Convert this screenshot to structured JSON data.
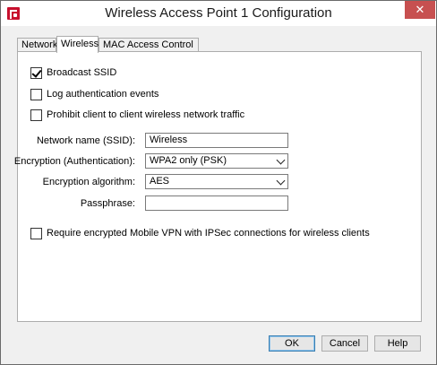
{
  "window": {
    "title": "Wireless Access Point 1 Configuration",
    "close_glyph": "✕",
    "icon": "watchguard-app-icon"
  },
  "tabs": [
    {
      "label": "Network",
      "active": false
    },
    {
      "label": "Wireless",
      "active": true
    },
    {
      "label": "MAC Access Control",
      "active": false
    }
  ],
  "options": {
    "broadcast_ssid": {
      "label": "Broadcast SSID",
      "checked": true
    },
    "log_auth": {
      "label": "Log authentication events",
      "checked": false
    },
    "prohibit_c2c": {
      "label": "Prohibit client to client wireless network traffic",
      "checked": false
    },
    "require_vpn": {
      "label": "Require encrypted Mobile VPN with IPSec connections for wireless clients",
      "checked": false
    }
  },
  "form": {
    "ssid": {
      "label": "Network name (SSID):",
      "value": "Wireless"
    },
    "encryption": {
      "label": "Encryption (Authentication):",
      "value": "WPA2 only (PSK)"
    },
    "algorithm": {
      "label": "Encryption algorithm:",
      "value": "AES"
    },
    "passphrase": {
      "label": "Passphrase:",
      "value": ""
    }
  },
  "buttons": {
    "ok": "OK",
    "cancel": "Cancel",
    "help": "Help"
  }
}
